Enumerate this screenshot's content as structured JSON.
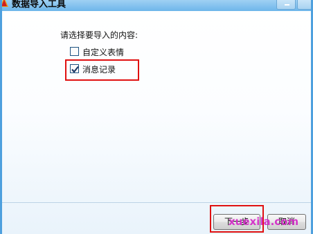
{
  "window": {
    "title": "数据导入工具",
    "icon": "app-icon"
  },
  "prompt": "请选择要导入的内容:",
  "options": [
    {
      "label": "自定义表情",
      "checked": false
    },
    {
      "label": "消息记录",
      "checked": true
    }
  ],
  "buttons": {
    "next": "下一步",
    "cancel": "取消"
  },
  "watermark": "xuexila.com",
  "colors": {
    "title_bar": "#6db6ea",
    "highlight": "#e01010",
    "watermark": "#d428c8"
  }
}
